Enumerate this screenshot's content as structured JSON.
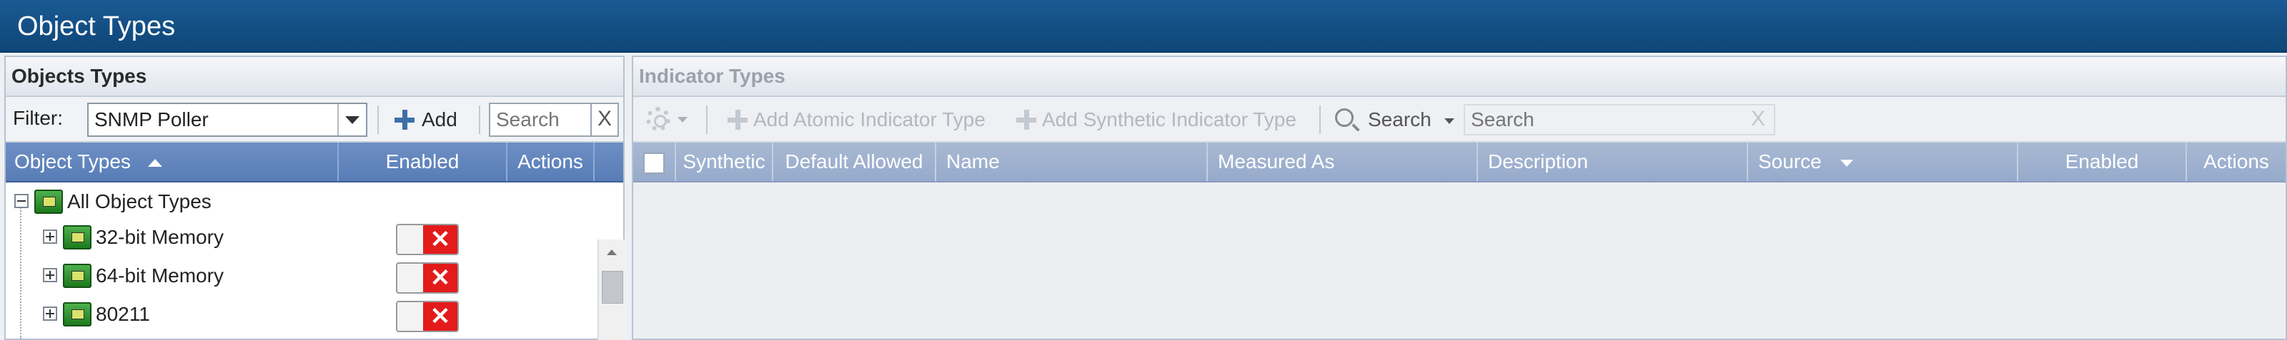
{
  "app": {
    "title": "Object Types"
  },
  "left_panel": {
    "title": "Objects Types",
    "filter": {
      "label": "Filter:",
      "value": "SNMP Poller"
    },
    "add_label": "Add",
    "search_placeholder": "Search",
    "clear_glyph": "X",
    "columns": {
      "name": "Object Types",
      "enabled": "Enabled",
      "actions": "Actions"
    },
    "tree": {
      "root": {
        "label": "All Object Types",
        "expanded": true
      },
      "children": [
        {
          "label": "32-bit Memory",
          "enabled": false
        },
        {
          "label": "64-bit Memory",
          "enabled": false
        },
        {
          "label": "80211",
          "enabled": false
        }
      ]
    },
    "toggle_off_glyph": "✕"
  },
  "right_panel": {
    "title": "Indicator Types",
    "toolbar": {
      "add_atomic": "Add Atomic Indicator Type",
      "add_synthetic": "Add Synthetic Indicator Type",
      "search_label": "Search",
      "search_placeholder": "Search",
      "clear_glyph": "X"
    },
    "columns": {
      "synthetic": "Synthetic",
      "default_allowed": "Default Allowed",
      "name": "Name",
      "measured_as": "Measured As",
      "description": "Description",
      "source": "Source",
      "enabled": "Enabled",
      "actions": "Actions"
    },
    "sorted_column": "source",
    "sort_direction": "descending"
  },
  "colors": {
    "title_bar": "#0e4677",
    "grid_header": "#587cb6",
    "grid_header_disabled": "#96aacb",
    "toggle_off": "#e31b1b",
    "tree_icon": "#1d7a1d"
  },
  "icons": [
    "plus-icon",
    "chevron-down-icon",
    "sort-ascending-icon",
    "sort-descending-icon",
    "gear-icon",
    "search-icon",
    "tree-node-icon",
    "expand-icon",
    "collapse-icon"
  ]
}
